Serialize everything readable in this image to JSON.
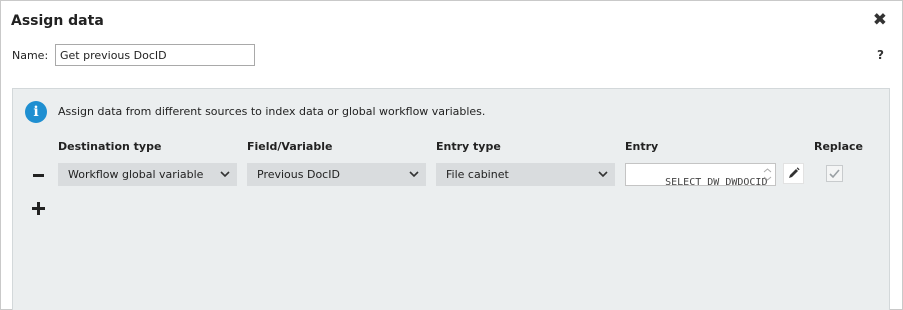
{
  "dialog": {
    "title": "Assign data",
    "close_glyph": "✖",
    "help_glyph": "?"
  },
  "name": {
    "label": "Name:",
    "value": "Get previous DocID"
  },
  "info": {
    "icon": "info-icon",
    "icon_glyph": "i",
    "text": "Assign data from different sources to index data or global workflow variables."
  },
  "columns": {
    "destination_type": "Destination type",
    "field_variable": "Field/Variable",
    "entry_type": "Entry type",
    "entry": "Entry",
    "replace": "Replace"
  },
  "row": {
    "destination_type": "Workflow global variable",
    "field_variable": "Previous DocID",
    "entry_type": "File cabinet",
    "entry_text": "SELECT DW_DWDOCID\nFROM Accounting",
    "replace_checked": true
  },
  "colors": {
    "accent": "#1f8fd1",
    "panel_bg": "#ebeeef",
    "select_bg": "#d9dcde"
  }
}
